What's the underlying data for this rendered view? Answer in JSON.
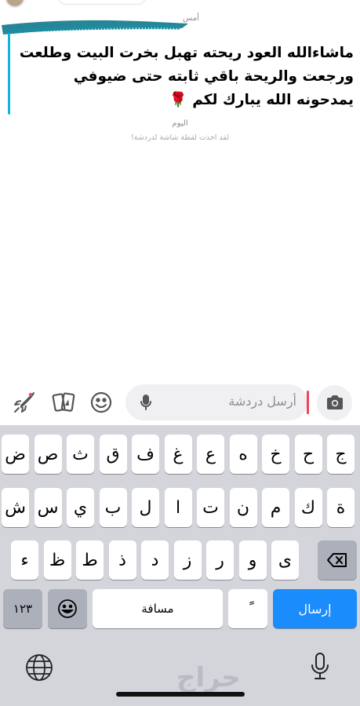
{
  "chat": {
    "day_yesterday": "أمس",
    "message_lines": [
      "ماشاءالله العود ريحته تهبل بخرت البيت وطلعت",
      "ورجعت والريحة باقي ثابته  حتى ضيوفي",
      "يمدحونه الله يبارك لكم 🌹"
    ],
    "day_today": "اليوم",
    "screenshot_notice": "لقد اخذت لقطة شاشة لدردشة!"
  },
  "input_bar": {
    "placeholder": "أرسل دردشة",
    "icons": [
      "rocket-icon",
      "cards-icon",
      "smiley-icon",
      "mic-icon",
      "camera-icon"
    ]
  },
  "keyboard": {
    "row1": [
      "ج",
      "ح",
      "خ",
      "ه",
      "ع",
      "غ",
      "ف",
      "ق",
      "ث",
      "ص",
      "ض"
    ],
    "row2": [
      "ة",
      "ك",
      "م",
      "ن",
      "ت",
      "ا",
      "ل",
      "ب",
      "ي",
      "س",
      "ش"
    ],
    "row3": [
      "ى",
      "و",
      "ر",
      "ز",
      "د",
      "ذ",
      "ط",
      "ظ",
      "ء"
    ],
    "numbers_key": "١٢٣",
    "space_key": "مسافة",
    "diacritic_key": "ً",
    "send_key": "إرسال",
    "watermark": "حراج"
  },
  "colors": {
    "accent_send": "#1a8cfb",
    "message_bar": "#12b5d9",
    "cursor": "#f0445b",
    "keyboard_bg": "#d3d5db"
  }
}
